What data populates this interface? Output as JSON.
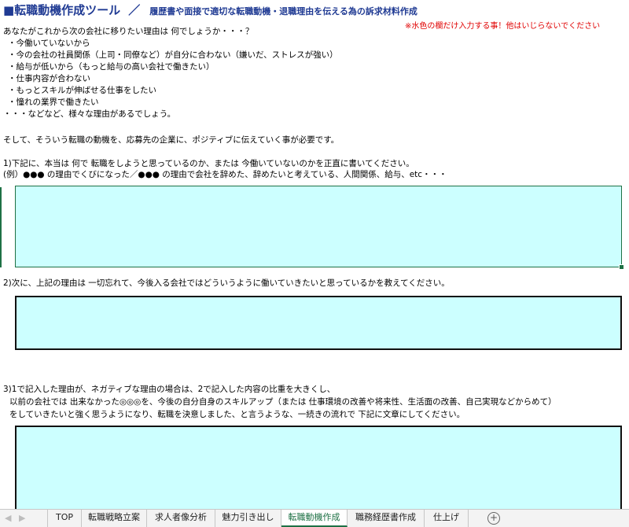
{
  "header": {
    "title": "■転職動機作成ツール",
    "slash": "／",
    "subtitle": "履歴書や面接で適切な転職動機・退職理由を伝える為の訴求材料作成",
    "warning": "※水色の欄だけ入力する事！他はいじらないでください"
  },
  "intro": {
    "question": "あなたがこれから次の会社に移りたい理由は 何でしょうか・・・？",
    "reasons": [
      "・今働いていないから",
      "・今の会社の社員関係（上司・同僚など）が自分に合わない（嫌いだ、ストレスが強い）",
      "・給与が低いから（もっと給与の高い会社で働きたい）",
      "・仕事内容が合わない",
      "・もっとスキルが伸ばせる仕事をしたい",
      "・憧れの業界で働きたい"
    ],
    "closing": "・・・などなど、様々な理由があるでしょう。",
    "positive": "そして、そういう転職の動機を、応募先の企業に、ポジティブに伝えていく事が必要です。"
  },
  "q1": {
    "text": "1)下記に、本当は 何で 転職をしようと思っているのか、または 今働いていないのかを正直に書いてください。",
    "example": "(例）●●● の理由でくびになった／●●● の理由で会社を辞めた、辞めたいと考えている、人間関係、給与、etc・・・"
  },
  "q2": {
    "text": "2)次に、上記の理由は 一切忘れて、今後入る会社ではどういうように働いていきたいと思っているかを教えてください。"
  },
  "q3": {
    "line1": "3)1で記入した理由が、ネガティブな理由の場合は、2で記入した内容の比重を大きくし、",
    "line2": "以前の会社では 出来なかった◎◎◎を、今後の自分自身のスキルアップ（または 仕事環境の改善や将来性、生活面の改善、自己実現などからめて）",
    "line3": "をしていきたいと強く思うようになり、転職を決意しました、と言うような、一続きの流れで 下記に文章にしてください。"
  },
  "tabs": [
    {
      "label": "TOP"
    },
    {
      "label": "転職戦略立案"
    },
    {
      "label": "求人者像分析"
    },
    {
      "label": "魅力引き出し"
    },
    {
      "label": "転職動機作成"
    },
    {
      "label": "職務経歴書作成"
    },
    {
      "label": "仕上げ"
    }
  ],
  "nav": {
    "prev": "◀",
    "next": "▶",
    "add": "+"
  },
  "active_tab": "転職動機作成",
  "colors": {
    "input_fill": "#ccffff",
    "accent": "#1e7145",
    "title": "#1f3a93",
    "warning": "#e00000"
  }
}
